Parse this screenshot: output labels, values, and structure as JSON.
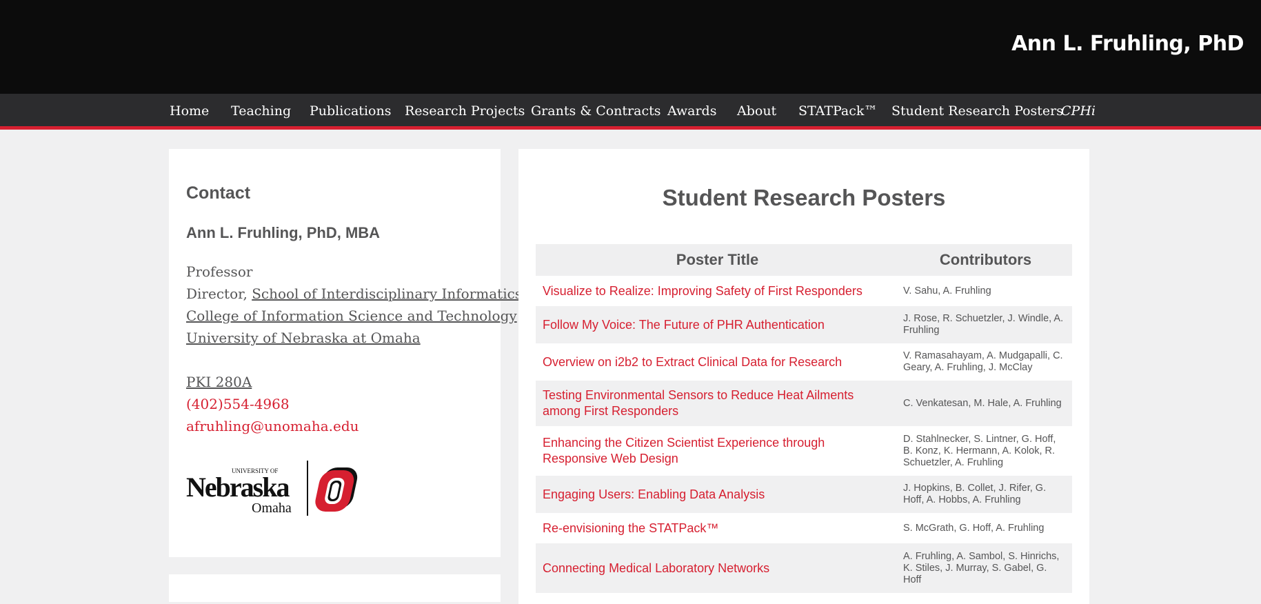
{
  "header": {
    "site_title": "Ann L. Fruhling, PhD"
  },
  "nav": {
    "items": [
      "Home",
      "Teaching",
      "Publications",
      "Research Projects",
      "Grants & Contracts",
      "Awards",
      "About",
      "STATPack™",
      "Student Research Posters",
      "CPHi"
    ]
  },
  "colors": {
    "accent": "#d61f30",
    "topbar": "#0c0c0c",
    "navbar": "#2c2c2e",
    "text": "#555556"
  },
  "sidebar": {
    "heading": "Contact",
    "name": "Ann L. Fruhling, PhD, MBA",
    "title_line": "Professor",
    "director_prefix": "Director, ",
    "director_link": "School of Interdisciplinary Informatics",
    "college_link": "College of Information Science and Technology",
    "university_link": "University of Nebraska at Omaha",
    "office": "PKI 280A",
    "phone": "(402)554-4968",
    "email": "afruhling@unomaha.edu",
    "logo": {
      "line1": "UNIVERSITY OF",
      "line2": "Nebraska",
      "line3": "Omaha"
    }
  },
  "main": {
    "title": "Student Research Posters",
    "columns": [
      "Poster Title",
      "Contributors"
    ],
    "rows": [
      {
        "title": "Visualize to Realize: Improving Safety of First Responders",
        "contributors": "V. Sahu, A. Fruhling"
      },
      {
        "title": "Follow My Voice: The Future of PHR Authentication",
        "contributors": "J. Rose, R. Schuetzler, J. Windle, A. Fruhling"
      },
      {
        "title": "Overview on i2b2 to Extract Clinical Data for Research",
        "contributors": "V. Ramasahayam, A. Mudgapalli, C. Geary, A. Fruhling, J. McClay"
      },
      {
        "title": "Testing Environmental Sensors to Reduce Heat Ailments among First Responders",
        "contributors": "C. Venkatesan, M. Hale, A. Fruhling"
      },
      {
        "title": "Enhancing the Citizen Scientist Experience through Responsive Web Design",
        "contributors": "D. Stahlnecker, S. Lintner, G. Hoff, B. Konz, K. Hermann, A. Kolok, R. Schuetzler, A. Fruhling"
      },
      {
        "title": "Engaging Users: Enabling Data Analysis",
        "contributors": "J. Hopkins, B. Collet, J. Rifer, G. Hoff, A. Hobbs, A. Fruhling"
      },
      {
        "title": "Re-envisioning the STATPack™",
        "contributors": "S. McGrath, G. Hoff, A. Fruhling"
      },
      {
        "title": "Connecting Medical Laboratory Networks",
        "contributors": "A. Fruhling, A. Sambol, S. Hinrichs, K. Stiles, J. Murray, S. Gabel, G. Hoff"
      }
    ]
  }
}
